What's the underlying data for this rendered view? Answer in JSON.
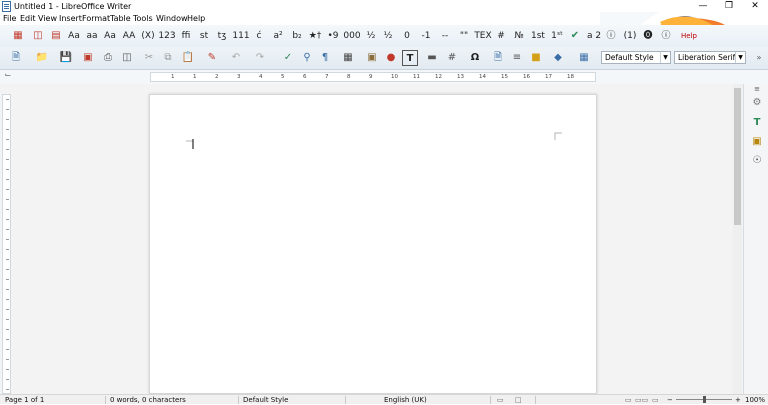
{
  "window": {
    "title": "Untitled 1 - LibreOffice Writer",
    "minimize": "—",
    "restore": "❐",
    "close": "✕"
  },
  "menu": [
    "File",
    "Edit",
    "View",
    "Insert",
    "Format",
    "Table",
    "Tools",
    "Window",
    "Help"
  ],
  "toolbar1": {
    "labels": [
      "Aa",
      "aa",
      "Aa",
      "AA",
      "(X)",
      "123",
      "ffi",
      "st",
      "tʒ",
      "111",
      "ć",
      "a²",
      "b₂",
      "★†",
      "•9",
      "000",
      "½",
      "½",
      "0",
      "-1",
      "--",
      "\"\"",
      "TEX",
      "#",
      "№",
      "1st",
      "1ˢᵗ",
      "a 2",
      "ⓘ",
      "(1)",
      "⓿",
      "ⓘ"
    ],
    "help_label": "Help"
  },
  "toolbar2": {
    "paragraph_style": "Default Style",
    "font_name": "Liberation Serif"
  },
  "ruler": {
    "numbers": [
      "1",
      "1",
      "2",
      "3",
      "4",
      "5",
      "6",
      "7",
      "8",
      "9",
      "10",
      "11",
      "12",
      "13",
      "14",
      "15",
      "16",
      "17",
      "18"
    ]
  },
  "status": {
    "page": "Page 1 of 1",
    "words": "0 words, 0 characters",
    "style": "Default Style",
    "language": "English (UK)",
    "zoom_percent": "100%",
    "zoom_level": 1.0
  },
  "colors": {
    "accent": "#3a6ea5",
    "firefox_orange": "#f57f1f",
    "firefox_blue": "#3e6fc2"
  }
}
